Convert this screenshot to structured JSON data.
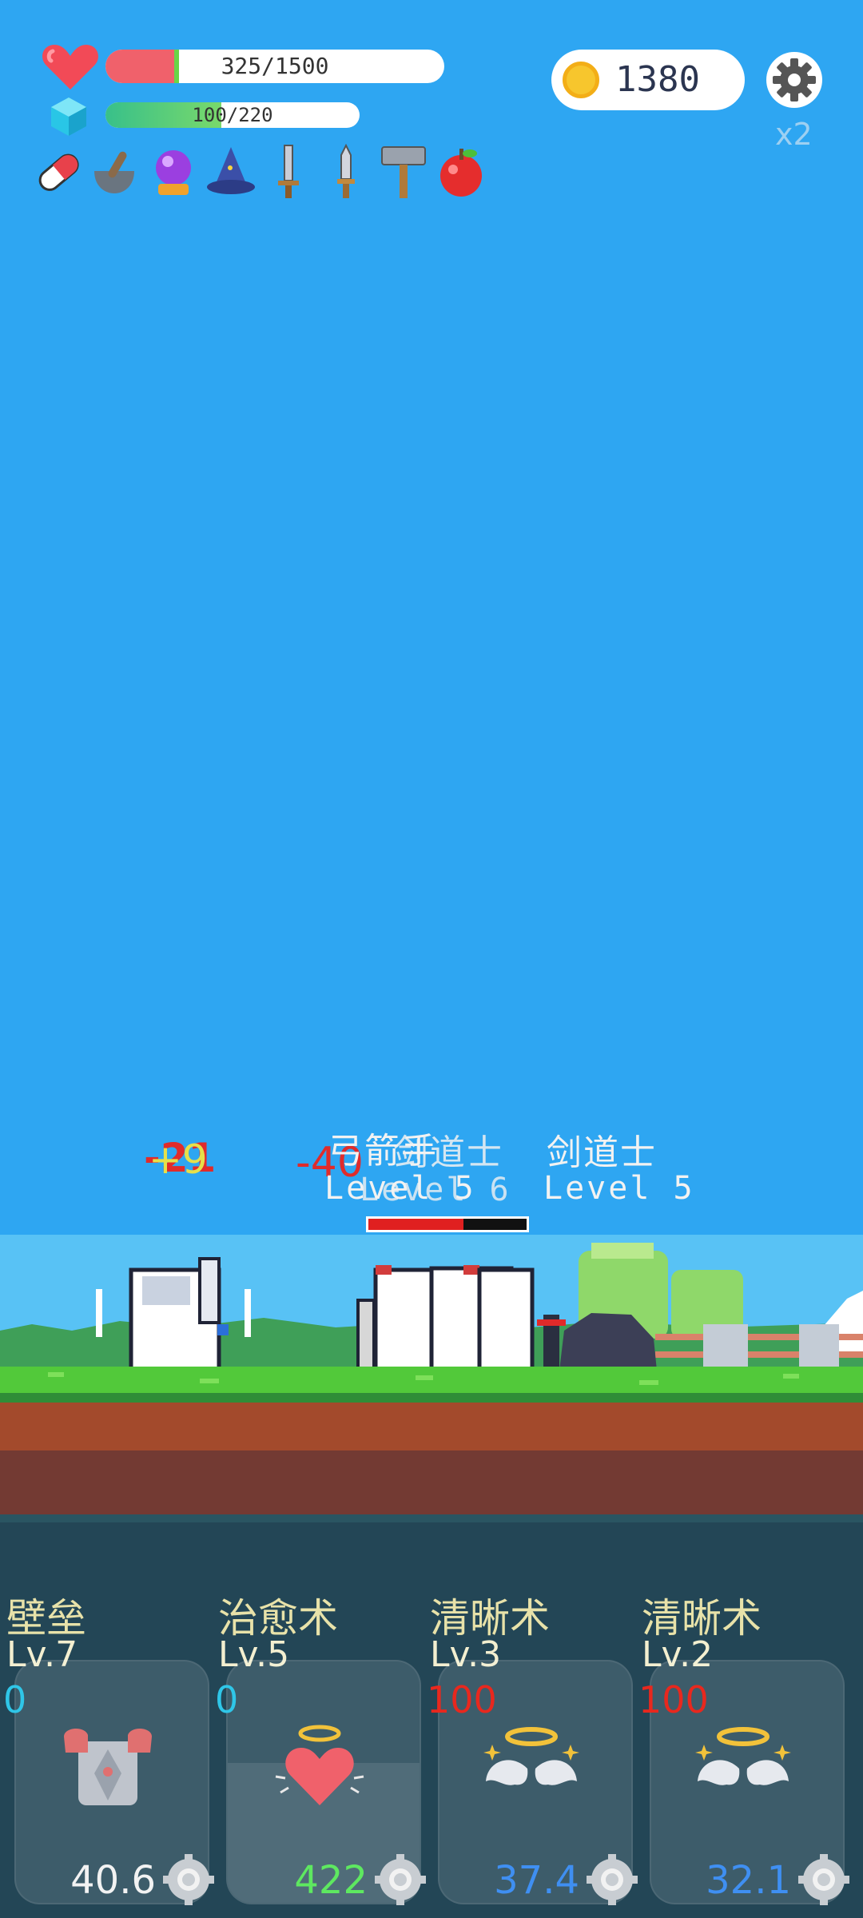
{
  "hud": {
    "hp_text": "325/1500",
    "hp_fraction": 0.217,
    "mp_text": "100/220",
    "mp_fraction": 0.455,
    "coins": "1380",
    "speed": "x2",
    "icons": [
      "heart-icon",
      "gem-icon",
      "coin-icon",
      "gear-icon"
    ]
  },
  "items": [
    "pill-icon",
    "mortar-icon",
    "crystal-ball-icon",
    "wizard-hat-icon",
    "sword-icon",
    "dagger-icon",
    "hammer-icon",
    "apple-icon"
  ],
  "battle": {
    "float_a": "-21",
    "float_b": "+9",
    "float_c": "-40",
    "enemy_name_1": "弓箭手",
    "enemy_name_2": "剑道士",
    "enemy_name_3": "剑道士",
    "enemy_level_1": "Level 5",
    "enemy_level_2": "Level 6",
    "enemy_level_3": "Level 5",
    "enemy_hp_fraction": 0.6,
    "colors": {
      "sky": "#2ea6f2",
      "grass": "#52c93a",
      "dirt": "#a34a2c",
      "panel": "#234656"
    }
  },
  "skills": [
    {
      "name": "壁垒",
      "level": "Lv.7",
      "cost": "0",
      "cost_color": "#2fc6e8",
      "value": "40.6",
      "value_color": "#f2f2f2",
      "icon": "armor-icon",
      "ready": 0.0
    },
    {
      "name": "治愈术",
      "level": "Lv.5",
      "cost": "0",
      "cost_color": "#2fc6e8",
      "value": "422",
      "value_color": "#5ee860",
      "icon": "heart-halo-icon",
      "ready": 0.58
    },
    {
      "name": "清晰术",
      "level": "Lv.3",
      "cost": "100",
      "cost_color": "#e8281e",
      "value": "37.4",
      "value_color": "#3f8ff2",
      "icon": "angel-wings-icon",
      "ready": 0.0
    },
    {
      "name": "清晰术",
      "level": "Lv.2",
      "cost": "100",
      "cost_color": "#e8281e",
      "value": "32.1",
      "value_color": "#3f8ff2",
      "icon": "angel-wings-icon",
      "ready": 0.0
    }
  ]
}
